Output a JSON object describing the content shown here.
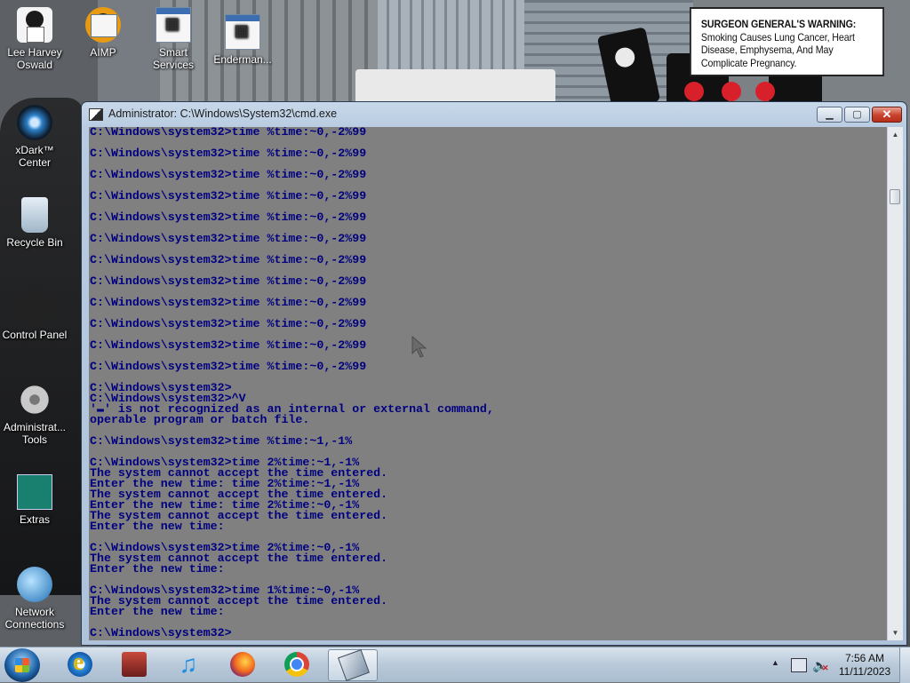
{
  "desktop": {
    "icons": [
      {
        "label": "Lee Harvey Oswald"
      },
      {
        "label": "AIMP"
      },
      {
        "label": "Smart Services"
      },
      {
        "label": "Enderman..."
      },
      {
        "label": "xDark™ Center"
      },
      {
        "label": "Recycle Bin"
      },
      {
        "label": "Control Panel"
      },
      {
        "label": "Administrat... Tools"
      },
      {
        "label": "Extras"
      },
      {
        "label": "Network Connections"
      }
    ],
    "warning": {
      "heading": "SURGEON GENERAL'S WARNING:",
      "body": "Smoking Causes Lung Cancer, Heart Disease, Emphysema, And May Complicate Pregnancy."
    }
  },
  "window": {
    "title": "Administrator: C:\\Windows\\System32\\cmd.exe",
    "minimize_glyph": "▁",
    "maximize_glyph": "▢",
    "close_glyph": "✕",
    "scroll_up_glyph": "▲",
    "scroll_down_glyph": "▼",
    "console_lines": [
      "C:\\Windows\\system32>time %time:~0,-2%99",
      "",
      "C:\\Windows\\system32>time %time:~0,-2%99",
      "",
      "C:\\Windows\\system32>time %time:~0,-2%99",
      "",
      "C:\\Windows\\system32>time %time:~0,-2%99",
      "",
      "C:\\Windows\\system32>time %time:~0,-2%99",
      "",
      "C:\\Windows\\system32>time %time:~0,-2%99",
      "",
      "C:\\Windows\\system32>time %time:~0,-2%99",
      "",
      "C:\\Windows\\system32>time %time:~0,-2%99",
      "",
      "C:\\Windows\\system32>time %time:~0,-2%99",
      "",
      "C:\\Windows\\system32>time %time:~0,-2%99",
      "",
      "C:\\Windows\\system32>time %time:~0,-2%99",
      "",
      "C:\\Windows\\system32>time %time:~0,-2%99",
      "",
      "C:\\Windows\\system32>",
      "C:\\Windows\\system32>^V",
      "'▬' is not recognized as an internal or external command,",
      "operable program or batch file.",
      "",
      "C:\\Windows\\system32>time %time:~1,-1%",
      "",
      "C:\\Windows\\system32>time 2%time:~1,-1%",
      "The system cannot accept the time entered.",
      "Enter the new time: time 2%time:~1,-1%",
      "The system cannot accept the time entered.",
      "Enter the new time: time 2%time:~0,-1%",
      "The system cannot accept the time entered.",
      "Enter the new time:",
      "",
      "C:\\Windows\\system32>time 2%time:~0,-1%",
      "The system cannot accept the time entered.",
      "Enter the new time:",
      "",
      "C:\\Windows\\system32>time 1%time:~0,-1%",
      "The system cannot accept the time entered.",
      "Enter the new time:",
      "",
      "C:\\Windows\\system32>"
    ]
  },
  "taskbar": {
    "clock_time": "7:56 AM",
    "clock_date": "11/11/2023",
    "tray_arrow_glyph": "▲",
    "volume_glyph": "🔈",
    "volume_muted_glyph": "✕",
    "pinned": [
      "internet-explorer",
      "media-center",
      "music-player",
      "firefox",
      "chrome",
      "command-prompt"
    ]
  },
  "colors": {
    "console_bg": "#808080",
    "console_fg": "#000080",
    "close_button": "#c8412b"
  }
}
